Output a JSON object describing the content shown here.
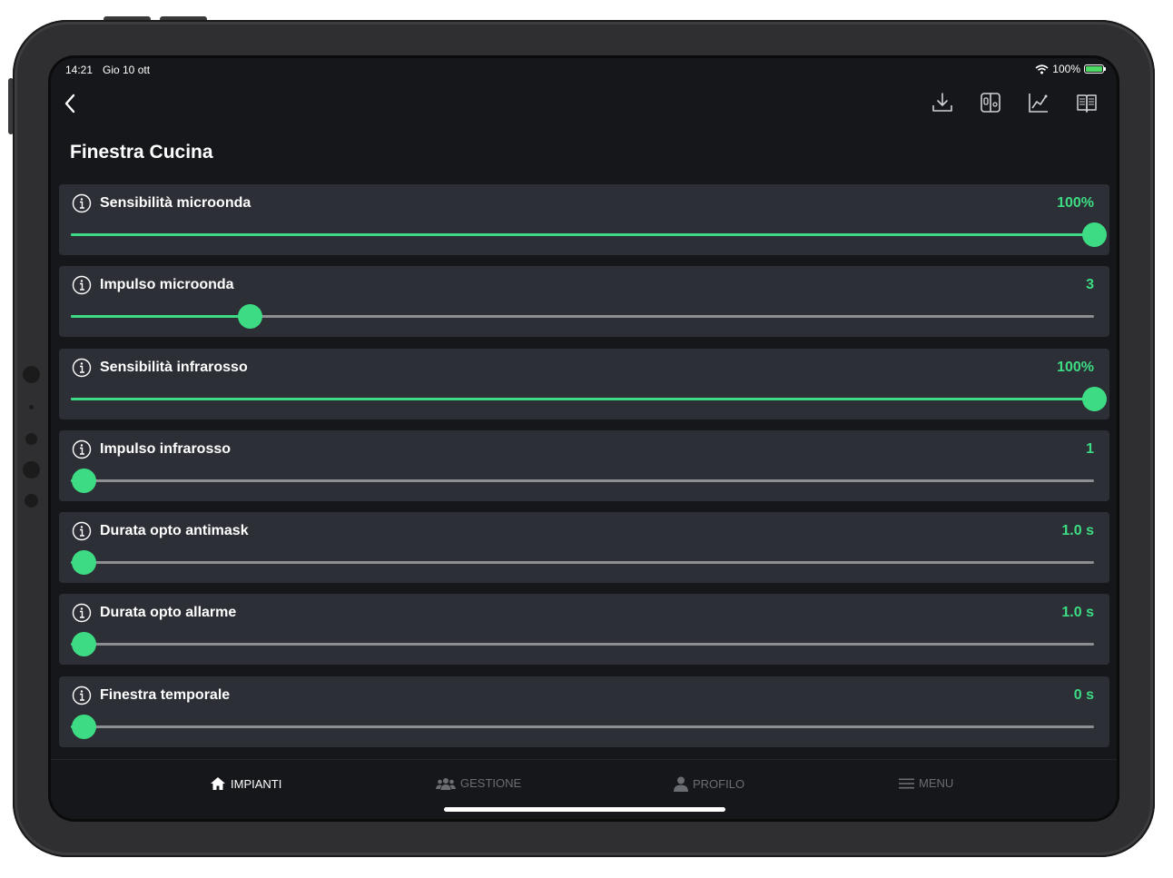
{
  "status": {
    "time": "14:21",
    "date": "Gio 10 ott",
    "battery": "100%"
  },
  "nav": {
    "toolbar_icons": [
      "download-icon",
      "device-panel-icon",
      "chart-icon",
      "manual-icon"
    ]
  },
  "page": {
    "title": "Finestra Cucina"
  },
  "settings": [
    {
      "label": "Sensibilità microonda",
      "value": "100%",
      "level": 1.0
    },
    {
      "label": "Impulso microonda",
      "value": "3",
      "level": 0.175
    },
    {
      "label": "Sensibilità infrarosso",
      "value": "100%",
      "level": 1.0
    },
    {
      "label": "Impulso infrarosso",
      "value": "1",
      "level": 0.012
    },
    {
      "label": "Durata opto antimask",
      "value": "1.0 s",
      "level": 0.012
    },
    {
      "label": "Durata opto allarme",
      "value": "1.0 s",
      "level": 0.012
    },
    {
      "label": "Finestra temporale",
      "value": "0 s",
      "level": 0.012
    }
  ],
  "tabs": [
    {
      "label": "IMPIANTI",
      "icon": "home-icon",
      "active": true
    },
    {
      "label": "GESTIONE",
      "icon": "users-icon",
      "active": false
    },
    {
      "label": "PROFILO",
      "icon": "person-icon",
      "active": false
    },
    {
      "label": "MENU",
      "icon": "menu-icon",
      "active": false
    }
  ],
  "colors": {
    "accent": "#3ddc84",
    "card": "#2c2f35",
    "background": "#15171a",
    "track": "#8c8e91"
  }
}
